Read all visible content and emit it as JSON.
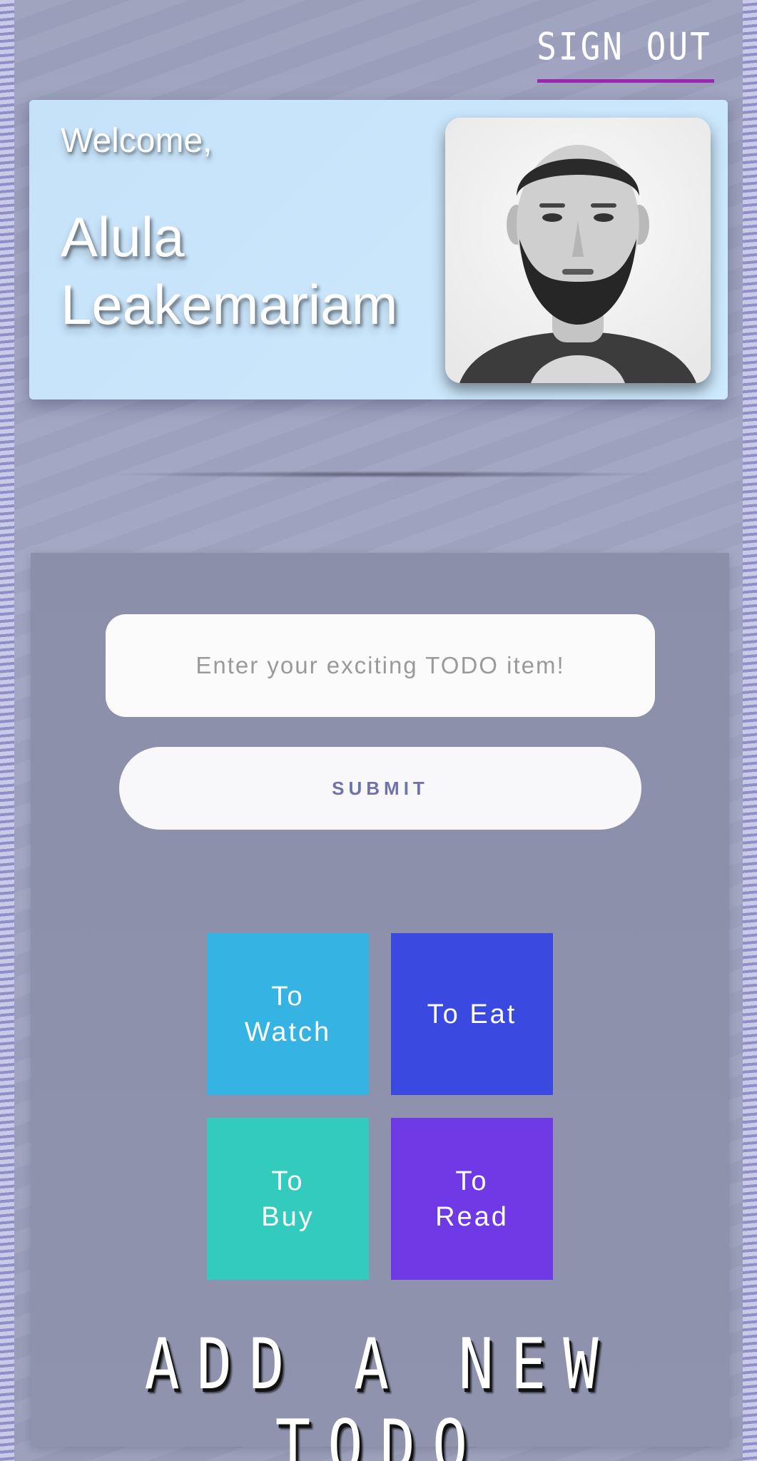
{
  "header": {
    "sign_out_label": "SIGN OUT",
    "accent_color": "#9c27b0"
  },
  "welcome": {
    "greeting": "Welcome,",
    "name_line1": "Alula",
    "name_line2": "Leakemariam"
  },
  "todo": {
    "input_placeholder": "Enter your exciting TODO item!",
    "submit_label": "SUBMIT"
  },
  "categories": [
    {
      "line1": "To",
      "line2": "Watch",
      "color": "#35b4e3"
    },
    {
      "line1": "To Eat",
      "line2": "",
      "color": "#3a4ae0"
    },
    {
      "line1": "To",
      "line2": "Buy",
      "color": "#33cbbd"
    },
    {
      "line1": "To",
      "line2": "Read",
      "color": "#7039e6"
    }
  ],
  "footer": {
    "title": "ADD A NEW TODO"
  }
}
